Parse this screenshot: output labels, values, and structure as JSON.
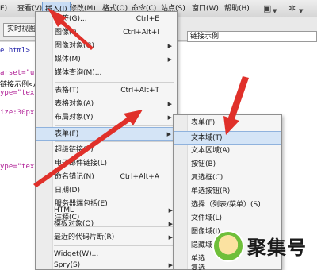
{
  "menubar": {
    "items": [
      {
        "label": "查看(V)"
      },
      {
        "label": "插入(I)"
      },
      {
        "label": "修改(M)"
      },
      {
        "label": "格式(O)"
      },
      {
        "label": "命令(C)"
      },
      {
        "label": "站点(S)"
      },
      {
        "label": "窗口(W)"
      },
      {
        "label": "帮助(H)"
      }
    ],
    "icons": [
      {
        "name": "layout-icon",
        "glyph": "▣"
      },
      {
        "name": "gear-icon",
        "glyph": "✲"
      }
    ],
    "partial_left": "E)"
  },
  "toolbar": {
    "live_view_label": "实时视图",
    "title_value": "链接示例"
  },
  "code": {
    "lines": [
      "e html>",
      "arset=\"ut",
      "链接示例</",
      "ype=\"text",
      "ize:30px;",
      "ype=\"text"
    ]
  },
  "insert_menu": {
    "items": [
      {
        "label": "标签(G)...",
        "shortcut": "Ctrl+E"
      },
      {
        "label": "图像(I)",
        "shortcut": "Ctrl+Alt+I"
      },
      {
        "label": "图像对象(G)",
        "shortcut": "",
        "submenu": true
      },
      {
        "label": "媒体(M)",
        "shortcut": "",
        "submenu": true
      },
      {
        "label": "媒体查询(M)...",
        "shortcut": ""
      },
      {
        "label": "表格(T)",
        "shortcut": "Ctrl+Alt+T"
      },
      {
        "label": "表格对象(A)",
        "shortcut": "",
        "submenu": true
      },
      {
        "label": "布局对象(Y)",
        "shortcut": "",
        "submenu": true
      },
      {
        "label": "表单(F)",
        "shortcut": "",
        "submenu": true
      },
      {
        "label": "超级链接(P)",
        "shortcut": ""
      },
      {
        "label": "电子邮件链接(L)",
        "shortcut": ""
      },
      {
        "label": "命名锚记(N)",
        "shortcut": "Ctrl+Alt+A"
      },
      {
        "label": "日期(D)",
        "shortcut": ""
      },
      {
        "label": "服务器端包括(E)",
        "shortcut": ""
      },
      {
        "label": "注释(C)",
        "shortcut": ""
      },
      {
        "label": "HTML",
        "shortcut": "",
        "submenu": true
      },
      {
        "label": "模板对象(O)",
        "shortcut": "",
        "submenu": true
      },
      {
        "label": "最近的代码片断(R)",
        "shortcut": "",
        "submenu": true
      },
      {
        "label": "Widget(W)...",
        "shortcut": ""
      },
      {
        "label": "Spry(S)",
        "shortcut": "",
        "submenu": true
      }
    ]
  },
  "form_submenu": {
    "items": [
      {
        "label": "表单(F)"
      },
      {
        "label": "文本域(T)"
      },
      {
        "label": "文本区域(A)"
      },
      {
        "label": "按钮(B)"
      },
      {
        "label": "复选框(C)"
      },
      {
        "label": "单选按钮(R)"
      },
      {
        "label": "选择（列表/菜单）(S)"
      },
      {
        "label": "文件域(L)"
      },
      {
        "label": "图像域(I)"
      },
      {
        "label": "隐藏域(H)"
      },
      {
        "label": "单选"
      },
      {
        "label": "复选"
      }
    ]
  },
  "colors": {
    "highlight": "#d4e4f6",
    "arrow": "#e0302a"
  },
  "watermark": {
    "text": "聚集号"
  }
}
